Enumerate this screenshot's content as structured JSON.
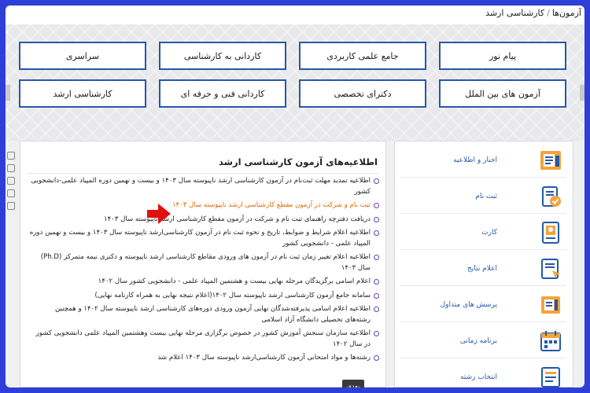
{
  "breadcrumb": {
    "parent": "آزمون‌ها",
    "current": "کارشناسی ارشد"
  },
  "categories": {
    "row1": [
      "پیام نور",
      "جامع علمی کاربردی",
      "کاردانی به کارشناسی",
      "سراسری"
    ],
    "row2": [
      "آزمون های بین الملل",
      "دکترای تخصصی",
      "کاردانی فنی و حرفه ای",
      "کارشناسی ارشد"
    ]
  },
  "news": {
    "title": "اطلاعیه‌های آزمون کارشناسی ارشد",
    "items": [
      "اطلاعیه تمدید مهلت ثبت‌نام در آزمون کارشناسی ارشد ناپیوسته سال ۱۴۰۳ و بیست و نهمین دوره المپیاد علمی-دانشجویی کشور",
      "ثبت نام و شرکت در آزمون مقطع کارشناسی ارشد ناپیوسته سال ۱۴۰۳",
      "دریافت دفترچه راهنمای ثبت نام و شرکت در آزمون مقطع کارشناسی ارشد ناپیوسته سال ۱۴۰۳",
      "اطلاعیه اعلام شرایط و ضوابط، تاریخ و نحوه ثبت نام در آزمون کارشناسی‌ارشد ناپیوسته سال ۱۴۰۳ و بیست و نهمین دوره المپیاد علمی - دانشجویی کشور",
      "اطلاعیه اعلام تغییر زمان ثبت نام در آزمون های ورودی مقاطع کارشناسی ارشد ناپیوسته و دکتری نیمه متمرکز (Ph.D) سال ۱۴۰۳",
      "اعلام اسامی برگزیدگان مرحله نهایی بیست و هشتمین المپیاد علمی - دانشجویی کشور سال ۱۴۰۲",
      "سامانه جامع آزمون کارشناسی ارشد ناپیوسته سال ۱۴۰۲(اعلام نتیجه نهایی به همراه کارنامه نهایی)",
      "اطلاعیه اعلام اسامی پذیرفته‌شدگان نهایی آزمون ورودی دوره‌های کارشناسی ارشد ناپیوسته سال ۱۴۰۲ و همچنین رشته‌های تحصیلی دانشگاه آزاد اسلامی",
      "اطلاعیه سازمان سنجش آموزش کشور  در خصوص برگزاری مرحله نهایی بیست وهشتمین المپیاد  علمی دانشجویی کشور در سال ۱۴۰۲",
      "رشته‌ها و مواد امتحانی آزمون کارشناسی‌ارشد ناپیوسته سال ۱۴۰۳ اعلام شد"
    ],
    "more_label": "بعدی"
  },
  "menu": {
    "items": [
      {
        "label": "اخبار و اطلاعیه",
        "icon": "news-icon"
      },
      {
        "label": "ثبت نام",
        "icon": "register-icon"
      },
      {
        "label": "کارت",
        "icon": "card-icon"
      },
      {
        "label": "اعلام نتایج",
        "icon": "results-icon"
      },
      {
        "label": "پرسش های متداول",
        "icon": "faq-icon"
      },
      {
        "label": "برنامه زمانی",
        "icon": "calendar-icon"
      },
      {
        "label": "انتخاب رشته",
        "icon": "field-selection-icon"
      }
    ]
  },
  "colors": {
    "frame_border": "#2d3fd6",
    "button_border": "#2458a8",
    "highlight_text": "#e06a00",
    "bullet": "#6a3fb5",
    "arrow": "#e01010"
  }
}
